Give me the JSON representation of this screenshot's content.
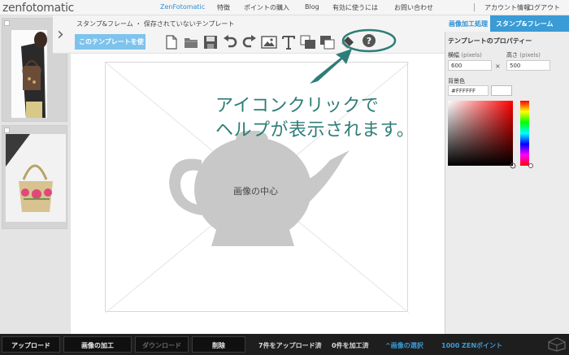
{
  "header": {
    "logo": "zenfotomatic",
    "nav": [
      "ZenFotomatic",
      "特徴",
      "ポイントの購入",
      "Blog",
      "有効に使うには",
      "お問い合わせ",
      "アカウント情報",
      "ログアウト"
    ]
  },
  "toolbar": {
    "breadcrumb": "スタンプ&フレーム ・ 保存されていないテンプレート",
    "use_button": "このテンプレートを使",
    "icons": [
      "new-file-icon",
      "open-folder-icon",
      "save-icon",
      "undo-icon",
      "redo-icon",
      "image-icon",
      "text-icon",
      "layer-front-icon",
      "layer-back-icon",
      "eraser-icon",
      "help-icon"
    ]
  },
  "canvas": {
    "center_label": "画像の中心"
  },
  "right_panel": {
    "tabs": [
      "画像加工処理",
      "スタンプ&フレーム"
    ],
    "props_title": "テンプレートのプロパティー",
    "width_label": "横幅",
    "width_unit": "(pixels)",
    "width_value": "600",
    "height_label": "高さ",
    "height_unit": "(pixels)",
    "height_value": "500",
    "times": "×",
    "bg_label": "背景色",
    "bg_value": "#FFFFFF"
  },
  "bottom_bar": {
    "buttons": [
      "アップロード",
      "画像の加工",
      "ダウンロード",
      "削除"
    ],
    "uploaded": "7件をアップロード済",
    "processed": "0件を加工済",
    "select": "^画像の選択",
    "points": "1000 ZENポイント"
  },
  "annotation": {
    "line1": "アイコンクリックで",
    "line2": "ヘルプが表示されます。"
  },
  "colors": {
    "accent_blue": "#3a9bd5",
    "annotation_teal": "#2e7d77",
    "teapot_gray": "#c8c8c8"
  }
}
